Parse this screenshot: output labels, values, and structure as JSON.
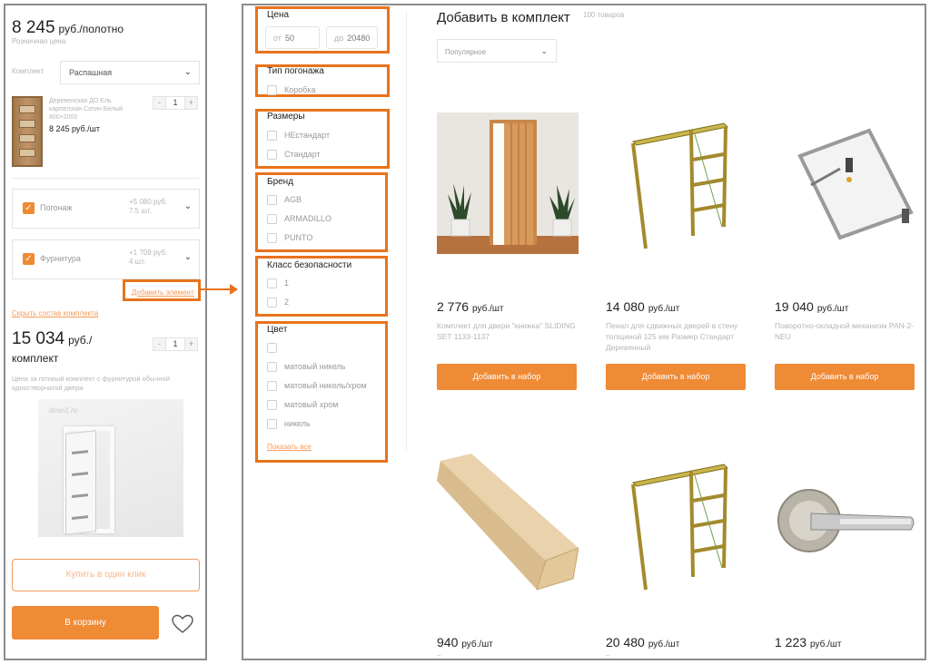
{
  "left": {
    "price_value": "8 245",
    "price_unit": "руб./полотно",
    "price_subtitle": "Розничная цена",
    "kit_label": "Комплект",
    "kit_select_value": "Распашная",
    "product": {
      "name": "Деревенская ДО Ель карпатская Сатин Белый 800×2000",
      "price": "8 245 руб./шт",
      "qty": "1"
    },
    "options": [
      {
        "label": "Погонаж",
        "price": "+5 080 руб.",
        "qty": "7.5 шт."
      },
      {
        "label": "Фурнитура",
        "price": "+1 709 руб.",
        "qty": "4 шт."
      }
    ],
    "add_element_link": "Добавить элемент",
    "hide_kit_link": "Скрыть состав комплекта",
    "total_value": "15 034",
    "total_unit": "руб./",
    "total_unit_2": "комплект",
    "total_qty": "1",
    "description": "Цена за готовый комплект с фурнитурой обычной одностворчатой двери",
    "image_watermark": "dveri1.ru",
    "one_click_label": "Купить в один клик",
    "cart_label": "В корзину",
    "stepper_minus": "-",
    "stepper_plus": "+"
  },
  "filters": {
    "price": {
      "title": "Цена",
      "from_prefix": "от",
      "from_value": "50",
      "to_prefix": "до",
      "to_value": "20480"
    },
    "moulding_type": {
      "title": "Тип погонажа",
      "options": [
        "Коробка"
      ]
    },
    "sizes": {
      "title": "Размеры",
      "options": [
        "НЕстандарт",
        "Стандарт"
      ]
    },
    "brand": {
      "title": "Бренд",
      "options": [
        "AGB",
        "ARMADILLO",
        "PUNTO"
      ]
    },
    "security_class": {
      "title": "Класс безопасности",
      "options": [
        "1",
        "2"
      ]
    },
    "color": {
      "title": "Цвет",
      "options": [
        "",
        "матовый никель",
        "матовый никель/хром",
        "матовый хром",
        "никель"
      ],
      "show_all": "Показать все"
    }
  },
  "main": {
    "title": "Добавить в комплект",
    "count": "100 товаров",
    "sort_value": "Популярное",
    "add_button_label": "Добавить в набор",
    "products": [
      {
        "price": "2 776",
        "unit": "руб./шт",
        "name": "Комплект для двери \"книжка\" SLIDING SET 1133-1137"
      },
      {
        "price": "14 080",
        "unit": "руб./шт",
        "name": "Пенал для сдвижных дверей в стену толщиной 125 мм Размер Стандарт Деревянный"
      },
      {
        "price": "19 040",
        "unit": "руб./шт",
        "name": "Поворотно-окладной механизм PAN-2-NEU"
      },
      {
        "price": "940",
        "unit": "руб./шт",
        "name": "–"
      },
      {
        "price": "20 480",
        "unit": "руб./шт",
        "name": "–"
      },
      {
        "price": "1 223",
        "unit": "руб./шт",
        "name": ""
      }
    ]
  },
  "colors": {
    "accent": "#ef8a35",
    "highlight": "#e8731c",
    "muted_text": "#b5b5b5"
  }
}
